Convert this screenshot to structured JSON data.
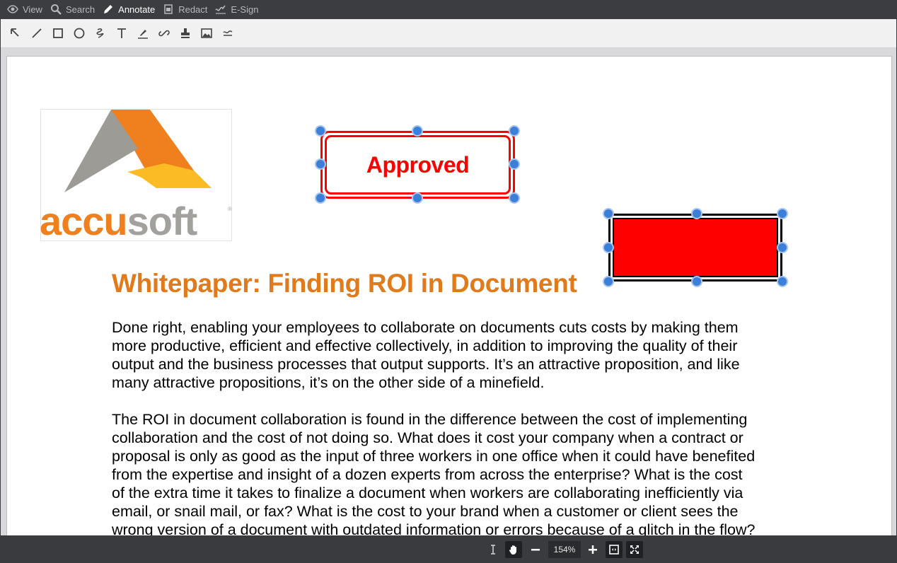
{
  "menu": {
    "items": [
      {
        "label": "View",
        "icon": "eye-icon"
      },
      {
        "label": "Search",
        "icon": "search-icon"
      },
      {
        "label": "Annotate",
        "icon": "pen-icon",
        "active": true
      },
      {
        "label": "Redact",
        "icon": "redact-icon"
      },
      {
        "label": "E-Sign",
        "icon": "signature-icon"
      }
    ]
  },
  "toolbar": {
    "tools": [
      "select-arrow-icon",
      "line-icon",
      "rectangle-icon",
      "ellipse-icon",
      "freehand-icon",
      "text-icon",
      "highlight-icon",
      "link-icon",
      "stamp-icon",
      "image-icon",
      "text-selection-icon"
    ]
  },
  "document": {
    "logo": {
      "accu": "accu",
      "soft": "soft",
      "tm": "®"
    },
    "stamp_label": "Approved",
    "title": "Whitepaper: Finding ROI in Document",
    "paragraph1": [
      "Done right, enabling your employees to collaborate on documents cuts costs by making them",
      "more productive, efficient and effective collectively, in addition to improving the quality of their",
      "output and the business processes that output supports. It’s an attractive proposition, and like",
      "many attractive propositions, it’s on the other side of a minefield."
    ],
    "paragraph2": [
      "The ROI in document collaboration is found in the difference between the cost of implementing",
      "collaboration and the cost of not doing so. What does it cost your company when a contract or",
      "proposal is only as good as the input of three workers in one office when it could have benefited",
      "from the expertise and insight of a dozen experts from across the enterprise? What is the cost",
      "of the extra time it takes to finalize a document when workers are collaborating inefficiently via",
      "email, or snail mail, or fax? What is the cost to your brand when a customer or client sees the",
      "wrong version of a document with outdated information or errors because of a glitch in the flow?"
    ]
  },
  "bottombar": {
    "zoom": "154%"
  },
  "colors": {
    "accent_orange": "#e07a1b",
    "stamp_red": "#ff0000",
    "handle_blue": "#3d7fd6",
    "menubar_bg": "#3c3d41"
  }
}
